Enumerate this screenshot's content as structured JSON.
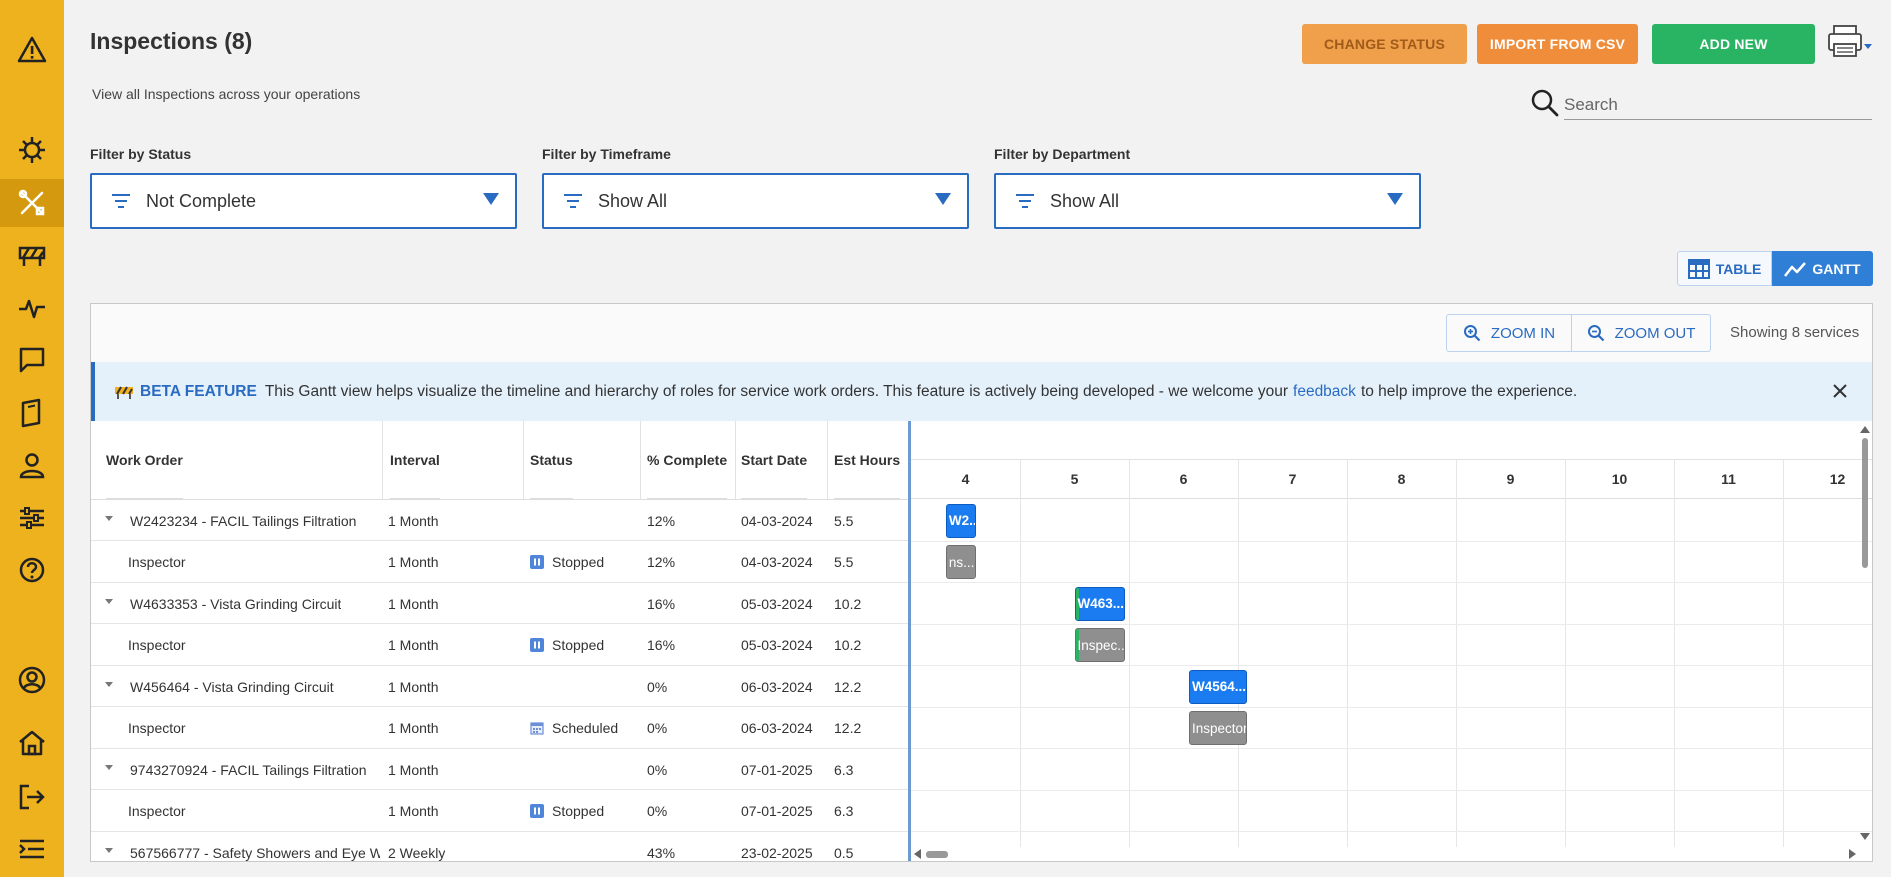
{
  "page": {
    "title": "Inspections (8)",
    "subtitle": "View all Inspections across your operations"
  },
  "toolbar": {
    "change_status": "CHANGE STATUS",
    "import_csv": "IMPORT FROM CSV",
    "add_new": "ADD NEW"
  },
  "search": {
    "placeholder": "Search"
  },
  "filters": {
    "status": {
      "label": "Filter by Status",
      "value": "Not Complete"
    },
    "timeframe": {
      "label": "Filter by Timeframe",
      "value": "Show All"
    },
    "department": {
      "label": "Filter by Department",
      "value": "Show All"
    }
  },
  "view_toggle": {
    "table": "TABLE",
    "gantt": "GANTT",
    "active": "gantt"
  },
  "gantt_panel": {
    "zoom_in": "ZOOM IN",
    "zoom_out": "ZOOM OUT",
    "showing": "Showing 8 services"
  },
  "beta": {
    "title": "BETA FEATURE",
    "text_before": "This Gantt view helps visualize the timeline and hierarchy of roles for service work orders. This feature is actively being developed - we welcome your",
    "link": "feedback",
    "text_after": "to help improve the experience."
  },
  "columns": [
    "Work Order",
    "Interval",
    "Status",
    "% Complete",
    "Start Date",
    "Est Hours"
  ],
  "rows": [
    {
      "wo": "W2423234 - FACIL Tailings Filtration",
      "interval": "1 Month",
      "status": "",
      "pct": "12%",
      "start": "04-03-2024",
      "hours": "5.5"
    },
    {
      "wo": "Inspector",
      "interval": "1 Month",
      "status": "Stopped",
      "pct": "12%",
      "start": "04-03-2024",
      "hours": "5.5"
    },
    {
      "wo": "W4633353 - Vista Grinding Circuit",
      "interval": "1 Month",
      "status": "",
      "pct": "16%",
      "start": "05-03-2024",
      "hours": "10.2"
    },
    {
      "wo": "Inspector",
      "interval": "1 Month",
      "status": "Stopped",
      "pct": "16%",
      "start": "05-03-2024",
      "hours": "10.2"
    },
    {
      "wo": "W456464 - Vista Grinding Circuit",
      "interval": "1 Month",
      "status": "",
      "pct": "0%",
      "start": "06-03-2024",
      "hours": "12.2"
    },
    {
      "wo": "Inspector",
      "interval": "1 Month",
      "status": "Scheduled",
      "pct": "0%",
      "start": "06-03-2024",
      "hours": "12.2"
    },
    {
      "wo": "9743270924 - FACIL Tailings Filtration",
      "interval": "1 Month",
      "status": "",
      "pct": "0%",
      "start": "07-01-2025",
      "hours": "6.3"
    },
    {
      "wo": "Inspector",
      "interval": "1 Month",
      "status": "Stopped",
      "pct": "0%",
      "start": "07-01-2025",
      "hours": "6.3"
    },
    {
      "wo": "567566777 - Safety Showers and Eye W...",
      "interval": "2 Weekly",
      "status": "",
      "pct": "43%",
      "start": "23-02-2025",
      "hours": "0.5"
    }
  ],
  "gantt_days": [
    "4",
    "5",
    "6",
    "7",
    "8",
    "9",
    "10",
    "11",
    "12"
  ],
  "gantt_bars": [
    {
      "row": 0,
      "start_day": 3.82,
      "length_days": 0.28,
      "label": "W2...",
      "kind": "parent",
      "progress": 0
    },
    {
      "row": 1,
      "start_day": 3.82,
      "length_days": 0.28,
      "label": "ns...",
      "kind": "child",
      "progress": 0
    },
    {
      "row": 2,
      "start_day": 5.0,
      "length_days": 0.46,
      "label": "W463...",
      "kind": "parent",
      "progress": 0.16
    },
    {
      "row": 3,
      "start_day": 5.0,
      "length_days": 0.46,
      "label": "Inspec...",
      "kind": "child",
      "progress": 0.16
    },
    {
      "row": 4,
      "start_day": 6.05,
      "length_days": 0.53,
      "label": "W4564...",
      "kind": "parent",
      "progress": 0
    },
    {
      "row": 5,
      "start_day": 6.05,
      "length_days": 0.53,
      "label": "Inspector",
      "kind": "child",
      "progress": 0
    }
  ],
  "colors": {
    "sidebar": "#eeb21e",
    "accent": "#2a6bc2",
    "add_new": "#28b463",
    "import": "#ef8d3b",
    "bar_parent": "#1a7cf0",
    "bar_child": "#8f8f8f",
    "status_stopped": "#4f86d9",
    "status_scheduled": "#6c8fd6"
  }
}
